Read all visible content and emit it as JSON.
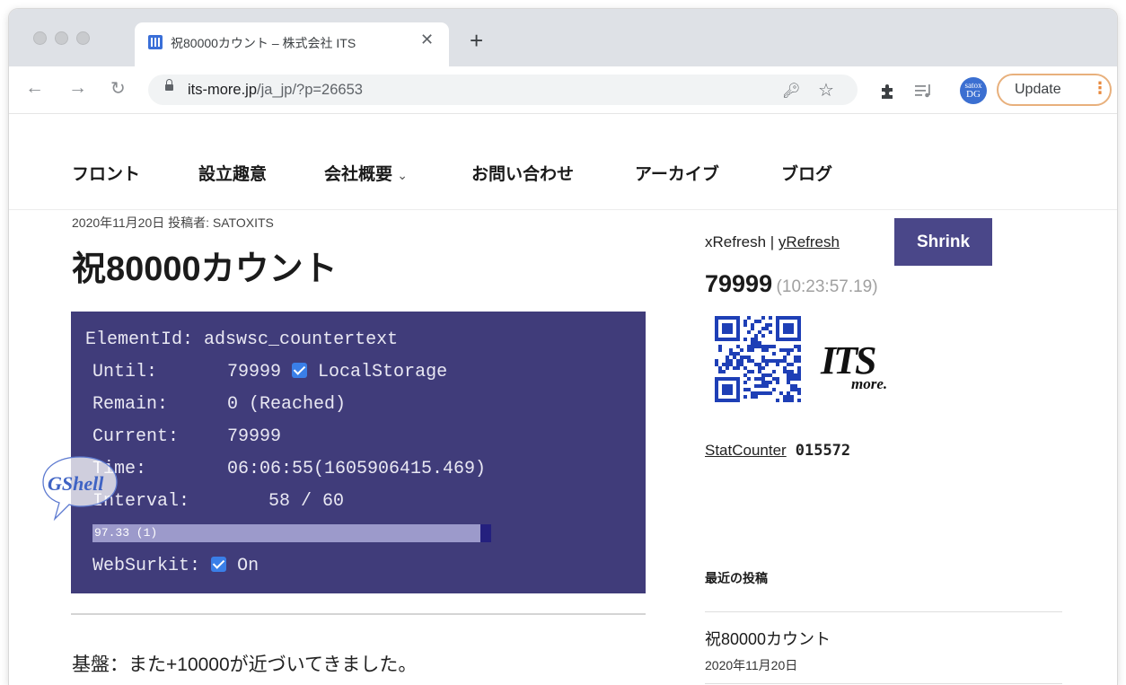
{
  "browser": {
    "tab_title": "祝80000カウント – 株式会社 ITS",
    "new_tab_icon": "plus-icon",
    "url_host": "its-more.jp",
    "url_path": "/ja_jp/?p=26653",
    "avatar_text_top": "satox",
    "avatar_text_bottom": "DG",
    "update_label": "Update",
    "update_accent": "#e8883b"
  },
  "nav": {
    "items": [
      "フロント",
      "設立趣意",
      "会社概要",
      "お問い合わせ",
      "アーカイブ",
      "ブログ"
    ]
  },
  "post": {
    "meta": "2020年11月20日 投稿者: SATOXITS",
    "title": "祝80000カウント",
    "body": "基盤：また+10000が近づいてきました。"
  },
  "panel": {
    "element_id_label": "ElementId:",
    "element_id_value": "adswsc_countertext",
    "until_label": "Until:",
    "until_value": "79999",
    "localstorage_label": "LocalStorage",
    "localstorage_checked": true,
    "remain_label": "Remain:",
    "remain_value": "0 (Reached)",
    "current_label": "Current:",
    "current_value": "79999",
    "time_label": "Time:",
    "time_value": "06:06:55(1605906415.469)",
    "interval_label": "Interval:",
    "interval_value": "58 / 60",
    "progress_text": "97.33 (1)",
    "progress_percent": 97.33,
    "websurkit_label": "WebSurkit:",
    "websurkit_value": "On",
    "websurkit_checked": true,
    "background_color": "#403c7a"
  },
  "gshell": {
    "label": "GShell"
  },
  "sidebar": {
    "xrefresh": "xRefresh",
    "separator": "|",
    "yrefresh": "yRefresh",
    "shrink_label": "Shrink",
    "count": "79999",
    "count_time": "(10:23:57.19)",
    "logo_text_main": "ITS",
    "logo_text_sub": "more.",
    "statcounter_label": "StatCounter",
    "statcounter_value": "015572",
    "recent_heading": "最近の投稿",
    "recent_posts": [
      {
        "title": "祝80000カウント",
        "date": "2020年11月20日"
      }
    ]
  }
}
